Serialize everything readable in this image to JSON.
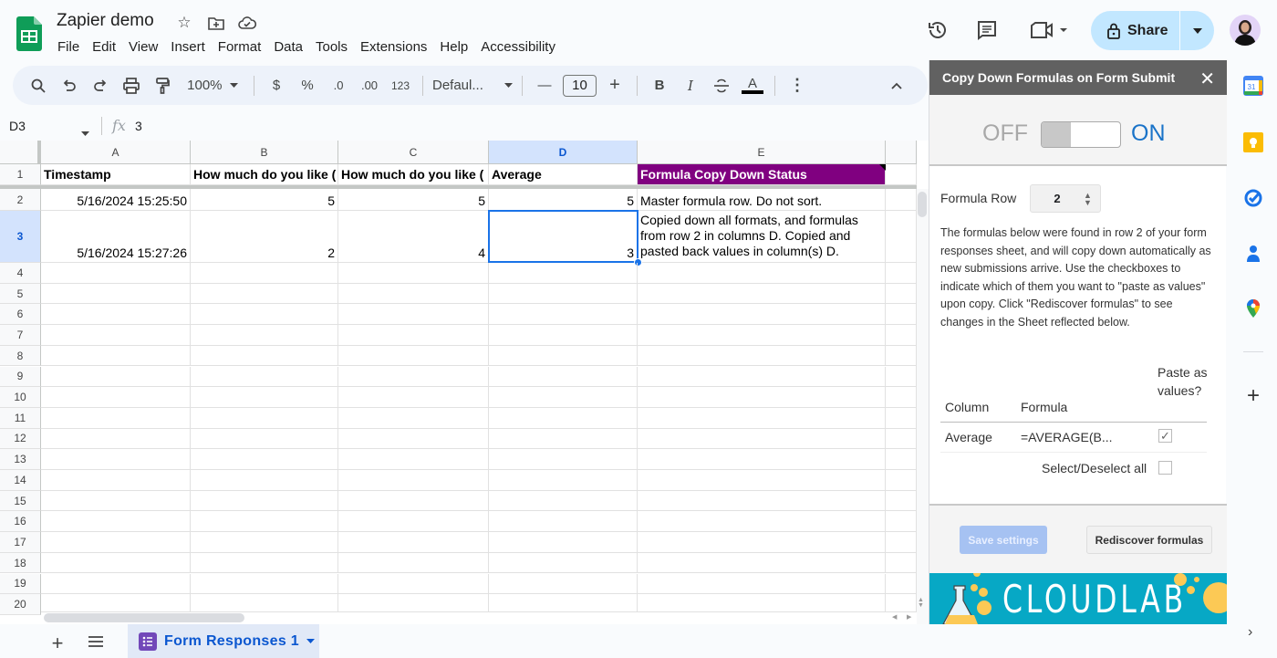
{
  "app": {
    "doc_title": "Zapier demo",
    "menu": [
      "File",
      "Edit",
      "View",
      "Insert",
      "Format",
      "Data",
      "Tools",
      "Extensions",
      "Help",
      "Accessibility"
    ],
    "share_label": "Share"
  },
  "toolbar": {
    "zoom": "100%",
    "currency": "$",
    "percent": "%",
    "decrease_decimal": ".0",
    "increase_decimal": ".00",
    "number_format": "123",
    "font": "Defaul...",
    "font_size": "10",
    "bold": "B",
    "italic": "I",
    "text_color": "A"
  },
  "formula_bar": {
    "cell_ref": "D3",
    "fx": "fx",
    "value": "3"
  },
  "grid": {
    "columns": [
      "A",
      "B",
      "C",
      "D",
      "E"
    ],
    "selected_column": "D",
    "selected_row": "3",
    "row_numbers": [
      "1",
      "2",
      "3",
      "4",
      "5",
      "6",
      "7",
      "8",
      "9",
      "10",
      "11",
      "12",
      "13",
      "14",
      "15",
      "16",
      "17",
      "18",
      "19",
      "20"
    ],
    "header_row": [
      "Timestamp",
      "How much do you like (",
      "How much do you like (",
      "Average",
      "Formula Copy Down Status"
    ],
    "rows": [
      [
        "5/16/2024 15:25:50",
        "5",
        "5",
        "5",
        "Master formula row. Do not sort."
      ],
      [
        "5/16/2024 15:27:26",
        "2",
        "4",
        "3",
        "Copied down all formats, and formulas from row 2 in columns D. Copied and pasted back values in column(s) D."
      ]
    ],
    "status_header_color": "#800080"
  },
  "sheet_tabs": {
    "active": "Form Responses 1"
  },
  "panel": {
    "title": "Copy Down Formulas on Form Submit",
    "toggle_off": "OFF",
    "toggle_on": "ON",
    "toggle_state": "on",
    "formula_row_label": "Formula Row",
    "formula_row_value": "2",
    "description": "The formulas below were found in row 2 of your form responses sheet, and will copy down automatically as new submissions arrive. Use the checkboxes to indicate which of them you want to \"paste as values\" upon copy. Click \"Rediscover formulas\" to see changes in the Sheet reflected below.",
    "table_headers": {
      "column": "Column",
      "formula": "Formula",
      "paste": "Paste as values?"
    },
    "table_rows": [
      {
        "column": "Average",
        "formula": "=AVERAGE(B...",
        "paste_checked": true
      }
    ],
    "select_all_label": "Select/Deselect all",
    "select_all_checked": false,
    "save_button": "Save settings",
    "rediscover_button": "Rediscover formulas",
    "banner_text": "CLOUDLAB"
  },
  "rail": {
    "icons": [
      "calendar-icon",
      "keep-icon",
      "tasks-icon",
      "contacts-icon",
      "maps-icon",
      "add-icon"
    ],
    "calendar_day": "31"
  }
}
